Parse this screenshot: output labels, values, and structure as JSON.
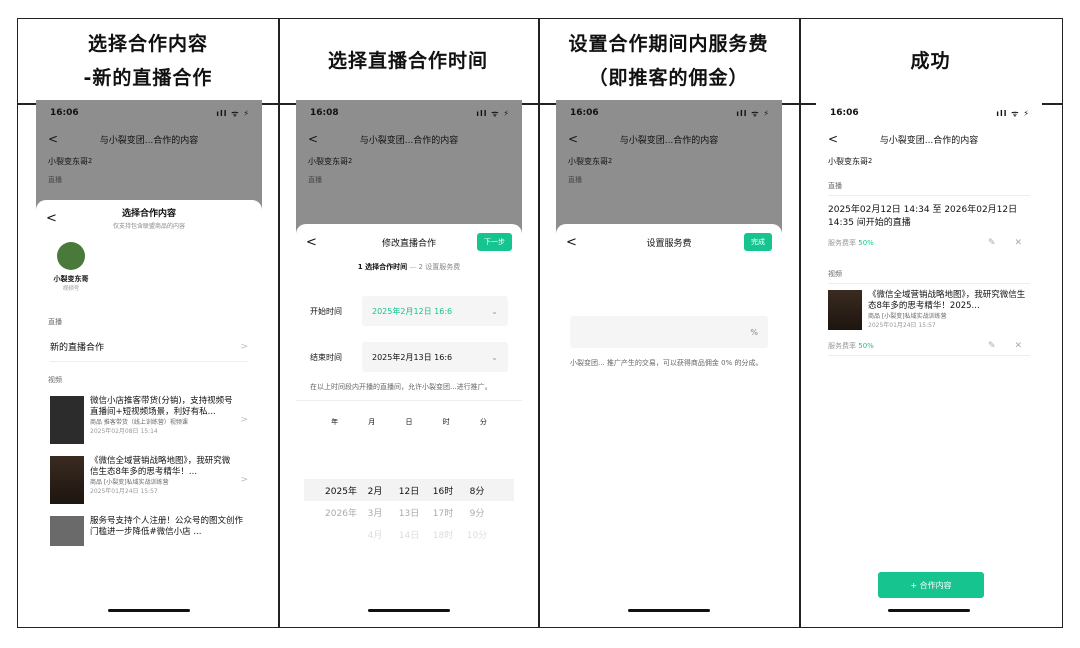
{
  "headers": [
    {
      "line1": "选择合作内容",
      "line2": "-新的直播合作"
    },
    {
      "line1": "选择直播合作时间",
      "line2": ""
    },
    {
      "line1": "设置合作期间内服务费",
      "line2": "（即推客的佣金）"
    },
    {
      "line1": "成功",
      "line2": ""
    }
  ],
  "common": {
    "back": "<",
    "nav_title": "与小裂变团...合作的内容",
    "account": "小裂变东哥",
    "account_sup": "2",
    "live_section": "直播",
    "video_section": "视频",
    "status_icons": "ıll ᯤ ⚡",
    "chevron": ">",
    "chevron_down": "⌄"
  },
  "p1": {
    "time": "16:06",
    "sheet_title": "选择合作内容",
    "sheet_sub": "仅支持包含联盟商品的内容",
    "account_name": "小裂变东哥",
    "account_type": "视频号",
    "live_item": "新的直播合作",
    "videos": [
      {
        "title": "微信小店推客带货(分销)，支持视频号直播间+短视频场景，利好有私...",
        "sub": "商品 推客带货（线上训练营）视频课",
        "date": "2025年02月08日 15:14"
      },
      {
        "title": "《微信全域营销战略地图》，我研究微信生态8年多的思考精华！...",
        "sub": "商品 [小裂变]私域实战训练营",
        "date": "2025年01月24日 15:57"
      },
      {
        "title": "服务号支持个人注册！公众号的图文创作门槛进一步降低#微信小店 ...",
        "sub": "",
        "date": ""
      }
    ]
  },
  "p2": {
    "time": "16:08",
    "sheet_title": "修改直播合作",
    "next": "下一步",
    "step1": "1 选择合作时间",
    "step_sep": "—",
    "step2": "2 设置服务费",
    "start_label": "开始时间",
    "start_value": "2025年2月12日 16:6",
    "end_label": "结束时间",
    "end_value": "2025年2月13日 16:6",
    "note": "在以上时间段内开播的直播间，允许小裂变团...进行推广。",
    "picker_headers": [
      "年",
      "月",
      "日",
      "时",
      "分"
    ],
    "picker_rows": [
      [
        "2025年",
        "2月",
        "12日",
        "16时",
        "8分"
      ],
      [
        "2026年",
        "3月",
        "13日",
        "17时",
        "9分"
      ],
      [
        "",
        "4月",
        "14日",
        "18时",
        "10分"
      ]
    ]
  },
  "p3": {
    "time": "16:06",
    "sheet_title": "设置服务费",
    "done": "完成",
    "percent": "%",
    "note": "小裂变团... 推广产生的交易，可以获得商品佣金 0% 的分成。"
  },
  "p4": {
    "time": "16:06",
    "live_text": "2025年02月12日 14:34 至 2026年02月12日 14:35 间开始的直播",
    "rate_label": "服务费率",
    "rate_value": "50%",
    "video_title": "《微信全域营销战略地图》，我研究微信生态8年多的思考精华！2025...",
    "video_sub": "商品 [小裂变]私域实战训练营",
    "video_date": "2025年01月24日 15:57",
    "edit_icons": "✎ ✕",
    "add_button": "+ 合作内容"
  },
  "colors": {
    "accent": "#16c48f",
    "overlay": "#8e8e8e"
  }
}
